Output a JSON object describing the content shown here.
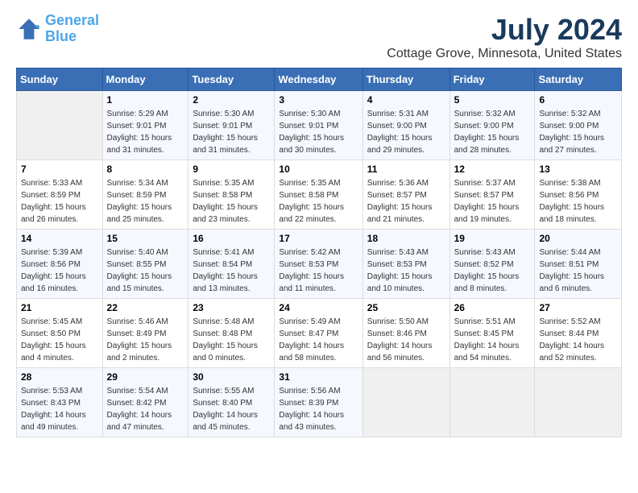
{
  "app": {
    "logo_line1": "General",
    "logo_line2": "Blue"
  },
  "title": "July 2024",
  "location": "Cottage Grove, Minnesota, United States",
  "weekdays": [
    "Sunday",
    "Monday",
    "Tuesday",
    "Wednesday",
    "Thursday",
    "Friday",
    "Saturday"
  ],
  "weeks": [
    [
      {
        "day": "",
        "empty": true
      },
      {
        "day": "1",
        "sunrise": "Sunrise: 5:29 AM",
        "sunset": "Sunset: 9:01 PM",
        "daylight": "Daylight: 15 hours and 31 minutes."
      },
      {
        "day": "2",
        "sunrise": "Sunrise: 5:30 AM",
        "sunset": "Sunset: 9:01 PM",
        "daylight": "Daylight: 15 hours and 31 minutes."
      },
      {
        "day": "3",
        "sunrise": "Sunrise: 5:30 AM",
        "sunset": "Sunset: 9:01 PM",
        "daylight": "Daylight: 15 hours and 30 minutes."
      },
      {
        "day": "4",
        "sunrise": "Sunrise: 5:31 AM",
        "sunset": "Sunset: 9:00 PM",
        "daylight": "Daylight: 15 hours and 29 minutes."
      },
      {
        "day": "5",
        "sunrise": "Sunrise: 5:32 AM",
        "sunset": "Sunset: 9:00 PM",
        "daylight": "Daylight: 15 hours and 28 minutes."
      },
      {
        "day": "6",
        "sunrise": "Sunrise: 5:32 AM",
        "sunset": "Sunset: 9:00 PM",
        "daylight": "Daylight: 15 hours and 27 minutes."
      }
    ],
    [
      {
        "day": "7",
        "sunrise": "Sunrise: 5:33 AM",
        "sunset": "Sunset: 8:59 PM",
        "daylight": "Daylight: 15 hours and 26 minutes."
      },
      {
        "day": "8",
        "sunrise": "Sunrise: 5:34 AM",
        "sunset": "Sunset: 8:59 PM",
        "daylight": "Daylight: 15 hours and 25 minutes."
      },
      {
        "day": "9",
        "sunrise": "Sunrise: 5:35 AM",
        "sunset": "Sunset: 8:58 PM",
        "daylight": "Daylight: 15 hours and 23 minutes."
      },
      {
        "day": "10",
        "sunrise": "Sunrise: 5:35 AM",
        "sunset": "Sunset: 8:58 PM",
        "daylight": "Daylight: 15 hours and 22 minutes."
      },
      {
        "day": "11",
        "sunrise": "Sunrise: 5:36 AM",
        "sunset": "Sunset: 8:57 PM",
        "daylight": "Daylight: 15 hours and 21 minutes."
      },
      {
        "day": "12",
        "sunrise": "Sunrise: 5:37 AM",
        "sunset": "Sunset: 8:57 PM",
        "daylight": "Daylight: 15 hours and 19 minutes."
      },
      {
        "day": "13",
        "sunrise": "Sunrise: 5:38 AM",
        "sunset": "Sunset: 8:56 PM",
        "daylight": "Daylight: 15 hours and 18 minutes."
      }
    ],
    [
      {
        "day": "14",
        "sunrise": "Sunrise: 5:39 AM",
        "sunset": "Sunset: 8:56 PM",
        "daylight": "Daylight: 15 hours and 16 minutes."
      },
      {
        "day": "15",
        "sunrise": "Sunrise: 5:40 AM",
        "sunset": "Sunset: 8:55 PM",
        "daylight": "Daylight: 15 hours and 15 minutes."
      },
      {
        "day": "16",
        "sunrise": "Sunrise: 5:41 AM",
        "sunset": "Sunset: 8:54 PM",
        "daylight": "Daylight: 15 hours and 13 minutes."
      },
      {
        "day": "17",
        "sunrise": "Sunrise: 5:42 AM",
        "sunset": "Sunset: 8:53 PM",
        "daylight": "Daylight: 15 hours and 11 minutes."
      },
      {
        "day": "18",
        "sunrise": "Sunrise: 5:43 AM",
        "sunset": "Sunset: 8:53 PM",
        "daylight": "Daylight: 15 hours and 10 minutes."
      },
      {
        "day": "19",
        "sunrise": "Sunrise: 5:43 AM",
        "sunset": "Sunset: 8:52 PM",
        "daylight": "Daylight: 15 hours and 8 minutes."
      },
      {
        "day": "20",
        "sunrise": "Sunrise: 5:44 AM",
        "sunset": "Sunset: 8:51 PM",
        "daylight": "Daylight: 15 hours and 6 minutes."
      }
    ],
    [
      {
        "day": "21",
        "sunrise": "Sunrise: 5:45 AM",
        "sunset": "Sunset: 8:50 PM",
        "daylight": "Daylight: 15 hours and 4 minutes."
      },
      {
        "day": "22",
        "sunrise": "Sunrise: 5:46 AM",
        "sunset": "Sunset: 8:49 PM",
        "daylight": "Daylight: 15 hours and 2 minutes."
      },
      {
        "day": "23",
        "sunrise": "Sunrise: 5:48 AM",
        "sunset": "Sunset: 8:48 PM",
        "daylight": "Daylight: 15 hours and 0 minutes."
      },
      {
        "day": "24",
        "sunrise": "Sunrise: 5:49 AM",
        "sunset": "Sunset: 8:47 PM",
        "daylight": "Daylight: 14 hours and 58 minutes."
      },
      {
        "day": "25",
        "sunrise": "Sunrise: 5:50 AM",
        "sunset": "Sunset: 8:46 PM",
        "daylight": "Daylight: 14 hours and 56 minutes."
      },
      {
        "day": "26",
        "sunrise": "Sunrise: 5:51 AM",
        "sunset": "Sunset: 8:45 PM",
        "daylight": "Daylight: 14 hours and 54 minutes."
      },
      {
        "day": "27",
        "sunrise": "Sunrise: 5:52 AM",
        "sunset": "Sunset: 8:44 PM",
        "daylight": "Daylight: 14 hours and 52 minutes."
      }
    ],
    [
      {
        "day": "28",
        "sunrise": "Sunrise: 5:53 AM",
        "sunset": "Sunset: 8:43 PM",
        "daylight": "Daylight: 14 hours and 49 minutes."
      },
      {
        "day": "29",
        "sunrise": "Sunrise: 5:54 AM",
        "sunset": "Sunset: 8:42 PM",
        "daylight": "Daylight: 14 hours and 47 minutes."
      },
      {
        "day": "30",
        "sunrise": "Sunrise: 5:55 AM",
        "sunset": "Sunset: 8:40 PM",
        "daylight": "Daylight: 14 hours and 45 minutes."
      },
      {
        "day": "31",
        "sunrise": "Sunrise: 5:56 AM",
        "sunset": "Sunset: 8:39 PM",
        "daylight": "Daylight: 14 hours and 43 minutes."
      },
      {
        "day": "",
        "empty": true
      },
      {
        "day": "",
        "empty": true
      },
      {
        "day": "",
        "empty": true
      }
    ]
  ]
}
